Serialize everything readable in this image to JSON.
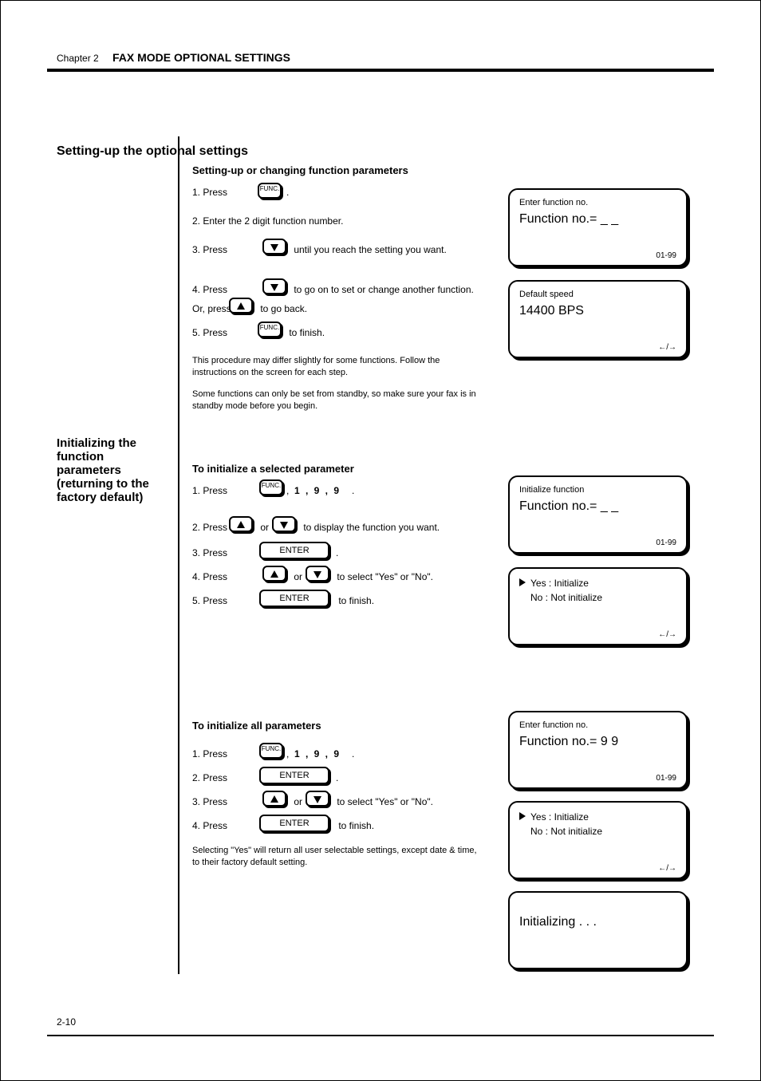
{
  "header": {
    "chapter": "Chapter 2",
    "title": "FAX MODE OPTIONAL SETTINGS"
  },
  "sections": [
    {
      "heading": "Setting-up the optional settings",
      "sub": "Setting-up or changing function parameters"
    },
    {
      "heading": "Initializing the function parameters (returning to the factory default)",
      "sub1": "To initialize a selected parameter",
      "sub2": "To initialize all parameters"
    }
  ],
  "text": {
    "s1l1a": "1. Press ",
    "s1l1b": ".",
    "s1l2": "2. Enter the 2 digit function number.",
    "s1l3a": "3. Press ",
    "s1l3b": " until you reach the setting you want.",
    "s1l4a": "4. Press ",
    "s1l4b": " to go on to set or change another function.",
    "s1l5a": "Or, press ",
    "s1l5b": " to go back.",
    "s1l6a": "5. Press ",
    "s1l6b": " to finish.",
    "s1note1": "This procedure may differ slightly for some functions. Follow the instructions on the screen for each step.",
    "s1note2": "Some functions can only be set from standby, so make sure your fax is in standby mode before you begin.",
    "s2l1a": "1. Press ",
    "s2l1b": ",",
    "s2l1c": ",",
    "s2l1d": ".",
    "s2l2a": "2. Press ",
    "s2l2b": " or ",
    "s2l2c": " to display the function you want.",
    "s2l3a": "3. Press ",
    "s2l3b": ".",
    "s2l4a": "4. Press ",
    "s2l4b": " or ",
    "s2l4c": " to select \"Yes\" or \"No\".",
    "s2l5a": "5. Press ",
    "s2l5b": " to finish.",
    "s3l1a": "1. Press ",
    "s3l1b": ",",
    "s3l1c": ",",
    "s3l1d": ".",
    "s3l2a": "2. Press ",
    "s3l2b": ".",
    "s3l3a": "3. Press ",
    "s3l3b": " or ",
    "s3l3c": " to select \"Yes\" or \"No\".",
    "s3l4a": "4. Press ",
    "s3l4b": " to finish.",
    "s3note": "Selecting \"Yes\" will return all user selectable settings, except date & time, to their factory default setting."
  },
  "buttons": {
    "func": "FUNC.",
    "enter": "ENTER",
    "digits": "1 , 9 , 9"
  },
  "displays": {
    "d1": {
      "l1": "Enter function no.",
      "l2": "Function no.= _ _",
      "foot": "01-99"
    },
    "d2": {
      "l1": "Default speed",
      "l2": "14400 BPS",
      "foot": "←/→"
    },
    "d3": {
      "l1": "Initialize function",
      "l2": "Function no.= _ _",
      "foot": "01-99"
    },
    "d4": {
      "l1": "Yes : Initialize",
      "l2": "No  : Not initialize",
      "foot": "←/→"
    },
    "d5": {
      "l1": "Enter function no.",
      "l2": "Function no.= 9 9",
      "foot": "01-99"
    },
    "d6": {
      "l1": "Yes : Initialize",
      "l2": "No  : Not initialize",
      "foot": "←/→"
    },
    "d7": {
      "l1": "Initializing . . ."
    }
  },
  "pagenum": "2-10"
}
